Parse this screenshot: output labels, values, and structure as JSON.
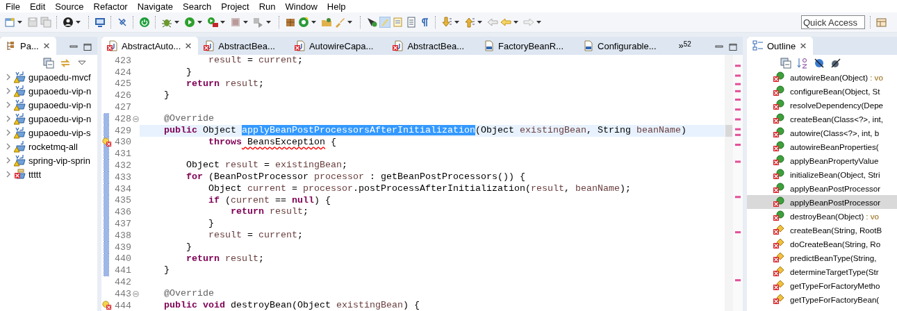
{
  "menu": [
    "File",
    "Edit",
    "Source",
    "Refactor",
    "Navigate",
    "Search",
    "Project",
    "Run",
    "Window",
    "Help"
  ],
  "quick_access": {
    "placeholder": "Quick Access"
  },
  "package_explorer": {
    "tab": {
      "label": "Pa...",
      "selected": true
    },
    "projects": [
      {
        "name": "gupaoedu-mvcf",
        "kind": "maven",
        "error": false,
        "expanded": false
      },
      {
        "name": "gupaoedu-vip-n",
        "kind": "maven",
        "error": false,
        "expanded": false
      },
      {
        "name": "gupaoedu-vip-n",
        "kind": "maven",
        "error": false,
        "expanded": false
      },
      {
        "name": "gupaoedu-vip-n",
        "kind": "maven",
        "error": false,
        "expanded": false
      },
      {
        "name": "gupaoedu-vip-s",
        "kind": "maven",
        "error": false,
        "expanded": false
      },
      {
        "name": "rocketmq-all",
        "kind": "java",
        "error": false,
        "expanded": false
      },
      {
        "name": "spring-vip-sprin",
        "kind": "maven",
        "error": false,
        "expanded": false
      },
      {
        "name": "ttttt",
        "kind": "plain",
        "error": true,
        "expanded": false
      }
    ]
  },
  "editor": {
    "tabs": [
      {
        "label": "AbstractAuto...",
        "kind": "source",
        "selected": true
      },
      {
        "label": "AbstractBea...",
        "kind": "source",
        "selected": false
      },
      {
        "label": "AutowireCapa...",
        "kind": "source",
        "selected": false
      },
      {
        "label": "AbstractBea...",
        "kind": "source",
        "selected": false
      },
      {
        "label": "FactoryBeanR...",
        "kind": "class",
        "selected": false
      },
      {
        "label": "Configurable...",
        "kind": "class",
        "selected": false
      }
    ],
    "overflow": {
      "glyph": "»",
      "count": "52"
    },
    "lines": [
      {
        "number": "423",
        "kind": "code",
        "current": false,
        "range": false,
        "tokens": [
          {
            "text": "            result",
            "kind": "var"
          },
          {
            "text": " = ",
            "kind": "plain"
          },
          {
            "text": "current",
            "kind": "var"
          },
          {
            "text": ";",
            "kind": "plain"
          }
        ]
      },
      {
        "number": "424",
        "kind": "code",
        "current": false,
        "range": false,
        "tokens": [
          {
            "text": "        }",
            "kind": "plain"
          }
        ]
      },
      {
        "number": "425",
        "kind": "code",
        "current": false,
        "range": false,
        "tokens": [
          {
            "text": "        return",
            "kind": "keyword"
          },
          {
            "text": " result",
            "kind": "var"
          },
          {
            "text": ";",
            "kind": "plain"
          }
        ]
      },
      {
        "number": "426",
        "kind": "code",
        "current": false,
        "range": false,
        "tokens": [
          {
            "text": "    }",
            "kind": "plain"
          }
        ]
      },
      {
        "number": "427",
        "kind": "code",
        "range": false
      },
      {
        "number": "428",
        "kind": "fold",
        "current": false,
        "range": true,
        "tokens": [
          {
            "text": "    @Override",
            "kind": "annotation"
          }
        ]
      },
      {
        "number": "429",
        "kind": "code",
        "current": true,
        "range": true,
        "tokens": [
          {
            "text": "    public",
            "kind": "keyword"
          },
          {
            "text": " Object ",
            "kind": "plain"
          },
          {
            "text": "applyBeanPostProcessorsAfterInitialization",
            "kind": "selection"
          },
          {
            "text": "(Object ",
            "kind": "plain"
          },
          {
            "text": "existingBean",
            "kind": "var"
          },
          {
            "text": ", String ",
            "kind": "plain"
          },
          {
            "text": "beanName",
            "kind": "var"
          },
          {
            "text": ")",
            "kind": "plain"
          }
        ]
      },
      {
        "number": "430",
        "kind": "error",
        "current": false,
        "range": true,
        "tokens": [
          {
            "text": "            throws",
            "kind": "keyword"
          },
          {
            "text": " BeansException",
            "kind": "error"
          },
          {
            "text": " {",
            "kind": "plain"
          }
        ]
      },
      {
        "number": "431",
        "kind": "code",
        "range": true
      },
      {
        "number": "432",
        "kind": "code",
        "current": false,
        "range": true,
        "tokens": [
          {
            "text": "        Object ",
            "kind": "plain"
          },
          {
            "text": "result",
            "kind": "var"
          },
          {
            "text": " = ",
            "kind": "plain"
          },
          {
            "text": "existingBean",
            "kind": "var"
          },
          {
            "text": ";",
            "kind": "plain"
          }
        ]
      },
      {
        "number": "433",
        "kind": "code",
        "current": false,
        "range": true,
        "tokens": [
          {
            "text": "        for",
            "kind": "keyword"
          },
          {
            "text": " (BeanPostProcessor ",
            "kind": "plain"
          },
          {
            "text": "processor",
            "kind": "var"
          },
          {
            "text": " : getBeanPostProcessors()) {",
            "kind": "plain"
          }
        ]
      },
      {
        "number": "434",
        "kind": "code",
        "current": false,
        "range": true,
        "tokens": [
          {
            "text": "            Object ",
            "kind": "plain"
          },
          {
            "text": "current",
            "kind": "var"
          },
          {
            "text": " = ",
            "kind": "plain"
          },
          {
            "text": "processor",
            "kind": "var"
          },
          {
            "text": ".postProcessAfterInitialization(",
            "kind": "plain"
          },
          {
            "text": "result",
            "kind": "var"
          },
          {
            "text": ", ",
            "kind": "plain"
          },
          {
            "text": "beanName",
            "kind": "var"
          },
          {
            "text": ");",
            "kind": "plain"
          }
        ]
      },
      {
        "number": "435",
        "kind": "code",
        "current": false,
        "range": true,
        "tokens": [
          {
            "text": "            if",
            "kind": "keyword"
          },
          {
            "text": " (",
            "kind": "plain"
          },
          {
            "text": "current",
            "kind": "var"
          },
          {
            "text": " == ",
            "kind": "plain"
          },
          {
            "text": "null",
            "kind": "keyword"
          },
          {
            "text": ") {",
            "kind": "plain"
          }
        ]
      },
      {
        "number": "436",
        "kind": "code",
        "current": false,
        "range": true,
        "tokens": [
          {
            "text": "                return",
            "kind": "keyword"
          },
          {
            "text": " result",
            "kind": "var"
          },
          {
            "text": ";",
            "kind": "plain"
          }
        ]
      },
      {
        "number": "437",
        "kind": "code",
        "current": false,
        "range": true,
        "tokens": [
          {
            "text": "            }",
            "kind": "plain"
          }
        ]
      },
      {
        "number": "438",
        "kind": "code",
        "current": false,
        "range": true,
        "tokens": [
          {
            "text": "            result",
            "kind": "var"
          },
          {
            "text": " = ",
            "kind": "plain"
          },
          {
            "text": "current",
            "kind": "var"
          },
          {
            "text": ";",
            "kind": "plain"
          }
        ]
      },
      {
        "number": "439",
        "kind": "code",
        "current": false,
        "range": true,
        "tokens": [
          {
            "text": "        }",
            "kind": "plain"
          }
        ]
      },
      {
        "number": "440",
        "kind": "code",
        "current": false,
        "range": true,
        "tokens": [
          {
            "text": "        return",
            "kind": "keyword"
          },
          {
            "text": " result",
            "kind": "var"
          },
          {
            "text": ";",
            "kind": "plain"
          }
        ]
      },
      {
        "number": "441",
        "kind": "code",
        "current": false,
        "range": true,
        "tokens": [
          {
            "text": "    }",
            "kind": "plain"
          }
        ]
      },
      {
        "number": "442",
        "kind": "code",
        "range": false
      },
      {
        "number": "443",
        "kind": "fold",
        "current": false,
        "range": false,
        "tokens": [
          {
            "text": "    @Override",
            "kind": "annotation"
          }
        ]
      },
      {
        "number": "444",
        "kind": "error",
        "current": false,
        "range": false,
        "tokens": [
          {
            "text": "    public",
            "kind": "keyword"
          },
          {
            "text": " void",
            "kind": "keyword"
          },
          {
            "text": " destroyBean(Object ",
            "kind": "plain"
          },
          {
            "text": "existingBean",
            "kind": "var"
          },
          {
            "text": ") {",
            "kind": "plain"
          }
        ]
      }
    ]
  },
  "outline": {
    "tab": {
      "label": "Outline",
      "selected": true
    },
    "items": [
      {
        "name": "autowireBean(Object)",
        "detail": ": vo",
        "kind": "public",
        "selected": false
      },
      {
        "name": "configureBean(Object, St",
        "kind": "public",
        "selected": false
      },
      {
        "name": "resolveDependency(Depe",
        "kind": "public",
        "selected": false
      },
      {
        "name": "createBean(Class<?>, int,",
        "kind": "public",
        "selected": false
      },
      {
        "name": "autowire(Class<?>, int, b",
        "kind": "public",
        "selected": false
      },
      {
        "name": "autowireBeanProperties(",
        "kind": "public",
        "selected": false
      },
      {
        "name": "applyBeanPropertyValue",
        "kind": "public",
        "selected": false
      },
      {
        "name": "initializeBean(Object, Stri",
        "kind": "public",
        "selected": false
      },
      {
        "name": "applyBeanPostProcessor",
        "kind": "public",
        "selected": false
      },
      {
        "name": "applyBeanPostProcessor",
        "kind": "public",
        "selected": true
      },
      {
        "name": "destroyBean(Object)",
        "detail": ": vo",
        "kind": "public",
        "selected": false
      },
      {
        "name": "createBean(String, RootB",
        "kind": "protected",
        "selected": false
      },
      {
        "name": "doCreateBean(String, Ro",
        "kind": "protected",
        "selected": false
      },
      {
        "name": "predictBeanType(String, ",
        "kind": "protected",
        "selected": false
      },
      {
        "name": "determineTargetType(Str",
        "kind": "protected",
        "selected": false
      },
      {
        "name": "getTypeForFactoryMetho",
        "kind": "protected",
        "selected": false
      },
      {
        "name": "getTypeForFactoryBean(",
        "kind": "protected",
        "selected": false
      }
    ]
  }
}
